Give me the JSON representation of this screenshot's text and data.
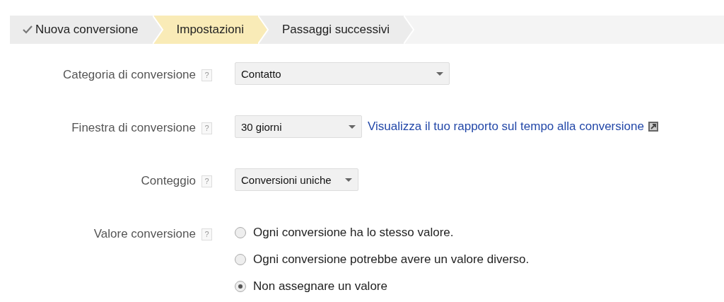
{
  "steps": [
    {
      "label": "Nuova conversione",
      "done": true,
      "selected": false
    },
    {
      "label": "Impostazioni",
      "done": false,
      "selected": true
    },
    {
      "label": "Passaggi successivi",
      "done": false,
      "selected": false
    }
  ],
  "fields": [
    {
      "kind": "select",
      "label": "Categoria di conversione",
      "help": "?",
      "value": "Contatto"
    },
    {
      "kind": "select",
      "label": "Finestra di conversione",
      "help": "?",
      "value": "30 giorni",
      "link": "Visualizza il tuo rapporto sul tempo alla conversione"
    },
    {
      "kind": "select",
      "label": "Conteggio",
      "help": "?",
      "value": "Conversioni uniche"
    },
    {
      "kind": "radio",
      "label": "Valore conversione",
      "help": "?",
      "options": [
        {
          "label": "Ogni conversione ha lo stesso valore.",
          "selected": false
        },
        {
          "label": "Ogni conversione potrebbe avere un valore diverso.",
          "selected": false
        },
        {
          "label": "Non assegnare un valore",
          "selected": true
        }
      ]
    }
  ]
}
